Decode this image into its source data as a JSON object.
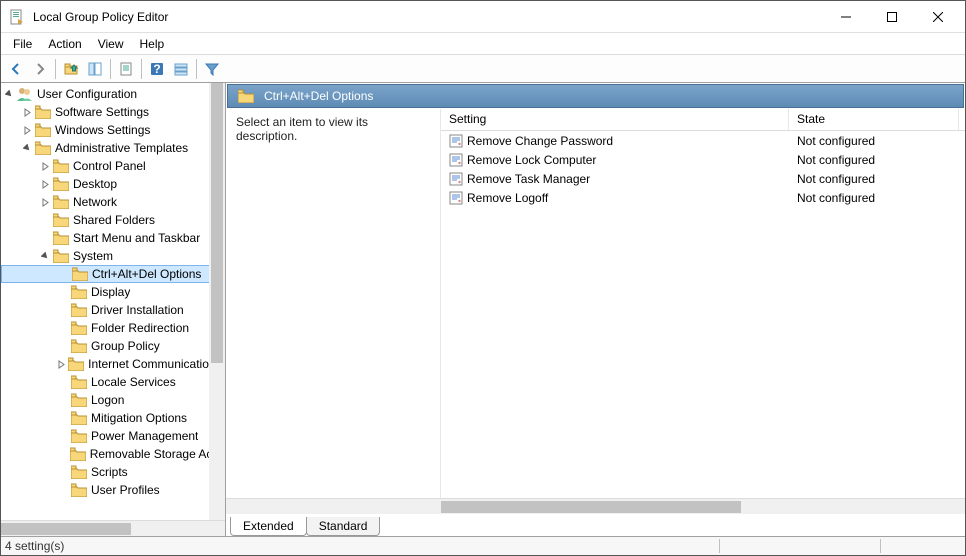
{
  "window": {
    "title": "Local Group Policy Editor"
  },
  "menu": {
    "file": "File",
    "action": "Action",
    "view": "View",
    "help": "Help"
  },
  "tree": {
    "root": "User Configuration",
    "software": "Software Settings",
    "windows": "Windows Settings",
    "admin": "Administrative Templates",
    "control_panel": "Control Panel",
    "desktop": "Desktop",
    "network": "Network",
    "shared": "Shared Folders",
    "startmenu": "Start Menu and Taskbar",
    "system": "System",
    "cad": "Ctrl+Alt+Del Options",
    "display": "Display",
    "driver": "Driver Installation",
    "folder_redir": "Folder Redirection",
    "group_policy": "Group Policy",
    "internet_comm": "Internet Communication Settings",
    "locale": "Locale Services",
    "logon": "Logon",
    "mitigation": "Mitigation Options",
    "power": "Power Management",
    "removable": "Removable Storage Access",
    "scripts": "Scripts",
    "user_profiles": "User Profiles"
  },
  "details": {
    "header": "Ctrl+Alt+Del Options",
    "desc": "Select an item to view its description.",
    "col_setting": "Setting",
    "col_state": "State",
    "rows": [
      {
        "setting": "Remove Change Password",
        "state": "Not configured"
      },
      {
        "setting": "Remove Lock Computer",
        "state": "Not configured"
      },
      {
        "setting": "Remove Task Manager",
        "state": "Not configured"
      },
      {
        "setting": "Remove Logoff",
        "state": "Not configured"
      }
    ]
  },
  "tabs": {
    "extended": "Extended",
    "standard": "Standard"
  },
  "status": {
    "count": "4 setting(s)"
  }
}
